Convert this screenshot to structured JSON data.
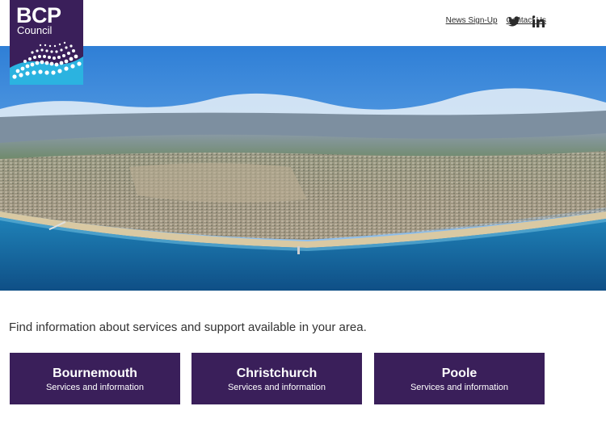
{
  "logo": {
    "line1": "BCP",
    "line2": "Council"
  },
  "nav": {
    "newsletter": "News Sign-Up",
    "contact": "Contact Us"
  },
  "social": {
    "twitter_icon": "twitter-icon",
    "linkedin_icon": "linkedin-icon"
  },
  "intro_text": "Find information about services and support available in your area.",
  "areas": [
    {
      "name": "Bournemouth",
      "subtitle": "Services and information"
    },
    {
      "name": "Christchurch",
      "subtitle": "Services and information"
    },
    {
      "name": "Poole",
      "subtitle": "Services and information"
    }
  ],
  "colors": {
    "brand_purple": "#3a1f5a",
    "logo_accent": "#2bb3e0",
    "sea_blue": "#1d6aa6"
  }
}
